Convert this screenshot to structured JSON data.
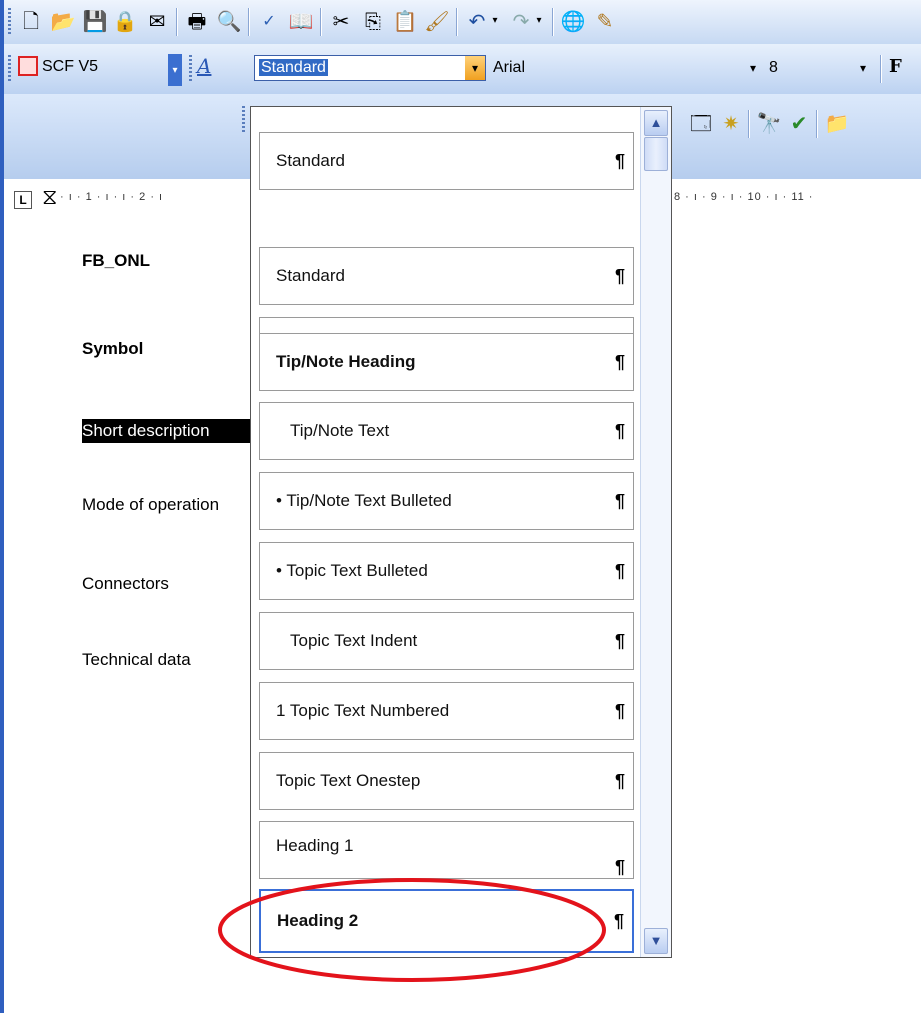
{
  "toolbar_formatting": {
    "scf_label": "SCF V5",
    "style_value": "Standard",
    "font_value": "Arial",
    "size_value": "8",
    "bold_label": "F"
  },
  "ruler": {
    "marks": [
      "1",
      "2",
      "8",
      "9",
      "10",
      "11"
    ]
  },
  "document": {
    "lines": [
      "FB_ONL",
      "Symbol",
      "Short description",
      "Mode of operation",
      "Connectors",
      "Technical data"
    ]
  },
  "style_list": {
    "items": [
      {
        "label": "Standard"
      },
      {
        "label": ""
      },
      {
        "label": "Tip/Note Heading"
      },
      {
        "label": "Tip/Note Text"
      },
      {
        "label": "• Tip/Note Text Bulleted"
      },
      {
        "label": "• Topic Text Bulleted"
      },
      {
        "label": "Topic Text Indent"
      },
      {
        "label": "1  Topic Text Numbered"
      },
      {
        "label": "Topic Text Onestep"
      },
      {
        "label": "Heading 1"
      },
      {
        "label": "Heading 2"
      }
    ],
    "pilcrow": "¶"
  },
  "colors": {
    "toolbar": "#c6d9f3",
    "selection": "#000000",
    "highlight_ellipse": "#e3131b",
    "panel_border": "#555555"
  }
}
